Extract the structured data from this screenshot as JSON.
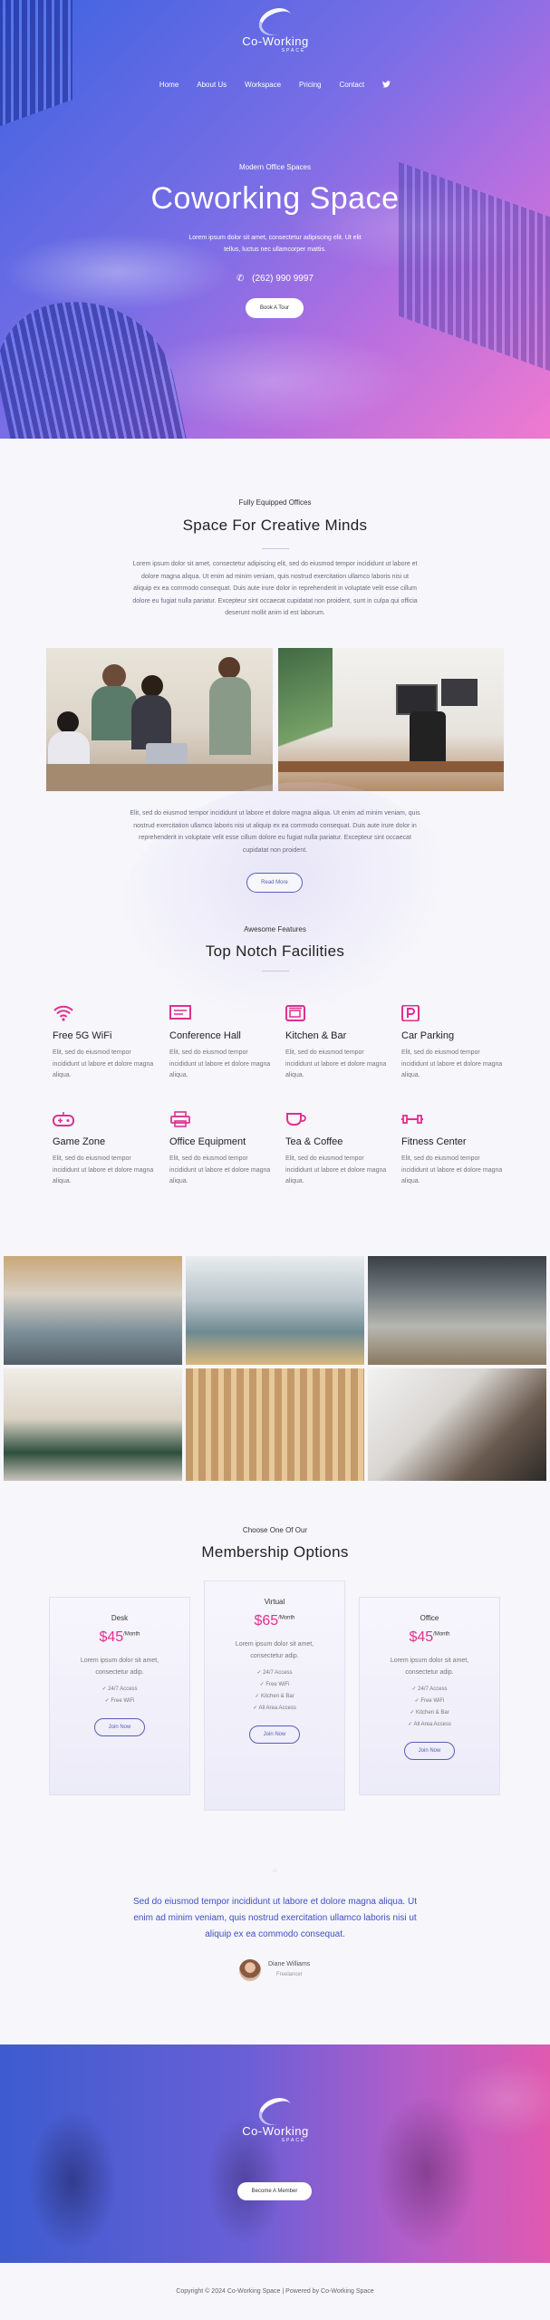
{
  "site": {
    "logo_name": "Co-Working",
    "logo_sub": "SPACE"
  },
  "nav": {
    "items": [
      "Home",
      "About Us",
      "Workspace",
      "Pricing",
      "Contact"
    ],
    "social_icon": "twitter-icon"
  },
  "hero": {
    "eyebrow": "Modern Office Spaces",
    "title": "Coworking Space",
    "text": "Lorem ipsum dolor sit amet, consectetur adipiscing elit. Ut elit tellus, luctus nec ullamcorper mattis.",
    "phone": "(262) 990 9997",
    "phone_icon": "phone-icon",
    "button": "Book A Tour"
  },
  "about": {
    "eyebrow": "Fully Equipped Offices",
    "title": "Space For Creative Minds",
    "text": "Lorem ipsum dolor sit amet, consectetur adipiscing elit, sed do eiusmod tempor incididunt ut labore et dolore magna aliqua. Ut enim ad minim veniam, quis nostrud exercitation ullamco laboris nisi ut aliquip ex ea commodo consequat. Duis aute irure dolor in reprehenderit in voluptate velit esse cillum dolore eu fugiat nulla pariatur. Excepteur sint occaecat cupidatat non proident, sunt in culpa qui officia deserunt mollit anim id est laborum.",
    "text2": "Elit, sed do eiusmod tempor incididunt ut labore et dolore magna aliqua. Ut enim ad minim veniam, quis nostrud exercitation ullamco laboris nisi ut aliquip ex ea commodo consequat. Duis aute irure dolor in reprehenderit in voluptate velit esse cillum dolore eu fugiat nulla pariatur. Excepteur sint occaecat cupidatat non proident.",
    "button": "Read More"
  },
  "facilities": {
    "eyebrow": "Awesome Features",
    "title": "Top Notch Facilities",
    "items": [
      {
        "icon": "wifi-icon",
        "title": "Free 5G WiFi",
        "text": "Elit, sed do eiusmod tempor incididunt ut labore et dolore magna aliqua."
      },
      {
        "icon": "presentation-icon",
        "title": "Conference Hall",
        "text": "Elit, sed do eiusmod tempor incididunt ut labore et dolore magna aliqua."
      },
      {
        "icon": "microwave-icon",
        "title": "Kitchen & Bar",
        "text": "Elit, sed do eiusmod tempor incididunt ut labore et dolore magna aliqua."
      },
      {
        "icon": "parking-icon",
        "title": "Car Parking",
        "text": "Elit, sed do eiusmod tempor incididunt ut labore et dolore magna aliqua."
      },
      {
        "icon": "gamepad-icon",
        "title": "Game Zone",
        "text": "Elit, sed do eiusmod tempor incididunt ut labore et dolore magna aliqua."
      },
      {
        "icon": "printer-icon",
        "title": "Office Equipment",
        "text": "Elit, sed do eiusmod tempor incididunt ut labore et dolore magna aliqua."
      },
      {
        "icon": "coffee-icon",
        "title": "Tea & Coffee",
        "text": "Elit, sed do eiusmod tempor incididunt ut labore et dolore magna aliqua."
      },
      {
        "icon": "dumbbell-icon",
        "title": "Fitness Center",
        "text": "Elit, sed do eiusmod tempor incididunt ut labore et dolore magna aliqua."
      }
    ]
  },
  "pricing": {
    "eyebrow": "Choose One Of Our",
    "title": "Membership Options",
    "plans": [
      {
        "name": "Desk",
        "price": "$45",
        "period": "/Month",
        "text": "Lorem ipsum dolor sit amet, consectetur adip.",
        "features": [
          "24/7 Access",
          "Free WiFi"
        ],
        "button": "Join Now"
      },
      {
        "name": "Virtual",
        "price": "$65",
        "period": "/Month",
        "text": "Lorem ipsum dolor sit amet, consectetur adip.",
        "features": [
          "24/7 Access",
          "Free WiFi",
          "Kitchen & Bar",
          "All Area Access"
        ],
        "button": "Join Now"
      },
      {
        "name": "Office",
        "price": "$45",
        "period": "/Month",
        "text": "Lorem ipsum dolor sit amet, consectetur adip.",
        "features": [
          "24/7 Access",
          "Free WiFi",
          "Kitchen & Bar",
          "All Area Access"
        ],
        "button": "Join Now"
      }
    ]
  },
  "testimonial": {
    "quote": "Sed do eiusmod tempor incididunt ut labore et dolore magna aliqua. Ut enim ad minim veniam, quis nostrud exercitation ullamco laboris nisi ut aliquip ex ea commodo consequat.",
    "name": "Diane Williams",
    "role": "Freelancer"
  },
  "cta": {
    "logo_name": "Co-Working",
    "logo_sub": "SPACE",
    "button": "Become A Member"
  },
  "footer": {
    "text": "Copyright © 2024 Co-Working Space | Powered by Co-Working Space"
  },
  "colors": {
    "accent_pink": "#e0308f",
    "accent_blue": "#5560b8",
    "quote_blue": "#3d4fc4"
  }
}
